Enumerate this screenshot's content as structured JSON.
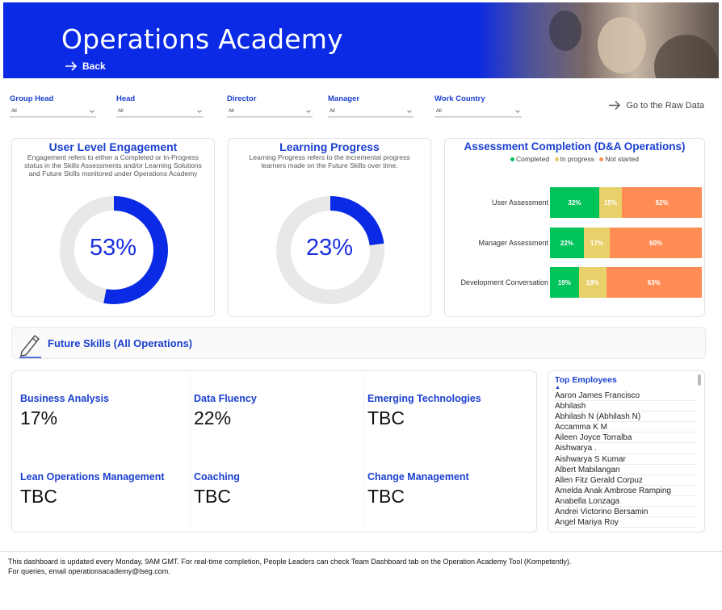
{
  "header": {
    "title": "Operations Academy",
    "back_label": "Back"
  },
  "filters": [
    {
      "label": "Group Head",
      "value": "All"
    },
    {
      "label": "Head",
      "value": "All"
    },
    {
      "label": "Director",
      "value": "All"
    },
    {
      "label": "Manager",
      "value": "All"
    },
    {
      "label": "Work Country",
      "value": "All"
    }
  ],
  "raw_data_link": "Go to the Raw Data",
  "engagement": {
    "title": "User Level Engagement",
    "description": "Engagement refers to either a Completed or In-Progress status in the Skills Assessments and/or Learning Solutions and Future Skills monitored under Operations Academy",
    "value_label": "53%",
    "percent": 53
  },
  "progress": {
    "title": "Learning Progress",
    "description": "Learning Progress refers to the incremental progress learners made on the Future Skills over time.",
    "value_label": "23%",
    "percent": 23
  },
  "assessment": {
    "title": "Assessment Completion (D&A Operations)",
    "legend": [
      "Completed",
      "In progress",
      "Not started"
    ],
    "colors": {
      "completed": "#00c35a",
      "in_progress": "#e8d06a",
      "not_started": "#ff8c55"
    },
    "rows": [
      {
        "label": "User Assessment",
        "completed": 32,
        "in_progress": 15,
        "not_started": 52,
        "c_label": "32%",
        "i_label": "15%",
        "n_label": "52%"
      },
      {
        "label": "Manager Assessment",
        "completed": 22,
        "in_progress": 17,
        "not_started": 60,
        "c_label": "22%",
        "i_label": "17%",
        "n_label": "60%"
      },
      {
        "label": "Development Conversation",
        "completed": 19,
        "in_progress": 18,
        "not_started": 63,
        "c_label": "19%",
        "i_label": "18%",
        "n_label": "63%"
      }
    ]
  },
  "future_skills": {
    "title": "Future Skills (All Operations)",
    "skills": [
      {
        "name": "Business Analysis",
        "value": "17%"
      },
      {
        "name": "Data Fluency",
        "value": "22%"
      },
      {
        "name": "Emerging Technologies",
        "value": "TBC"
      },
      {
        "name": "Lean Operations Management",
        "value": "TBC"
      },
      {
        "name": "Coaching",
        "value": "TBC"
      },
      {
        "name": "Change Management",
        "value": "TBC"
      }
    ]
  },
  "top_employees": {
    "title": "Top Employees",
    "items": [
      "Aaron James Francisco",
      "Abhilash",
      "Abhilash N (Abhilash N)",
      "Accamma K M",
      "Aileen Joyce Torralba",
      "Aishwarya .",
      "Aishwarya S Kumar",
      "Albert Mabilangan",
      "Allen Fitz Gerald Corpuz",
      "Amelda Anak Ambrose Ramping",
      "Anabella Lonzaga",
      "Andrei Victorino Bersamin",
      "Angel Mariya Roy"
    ]
  },
  "footer": {
    "line1": "This dashboard is updated every Monday, 9AM GMT.  For real-time completion, People Leaders can check Team Dashboard tab on the Operation Academy Tool  (Kompetently).",
    "line2": "For queries, email operationsacademy@lseg.com."
  }
}
